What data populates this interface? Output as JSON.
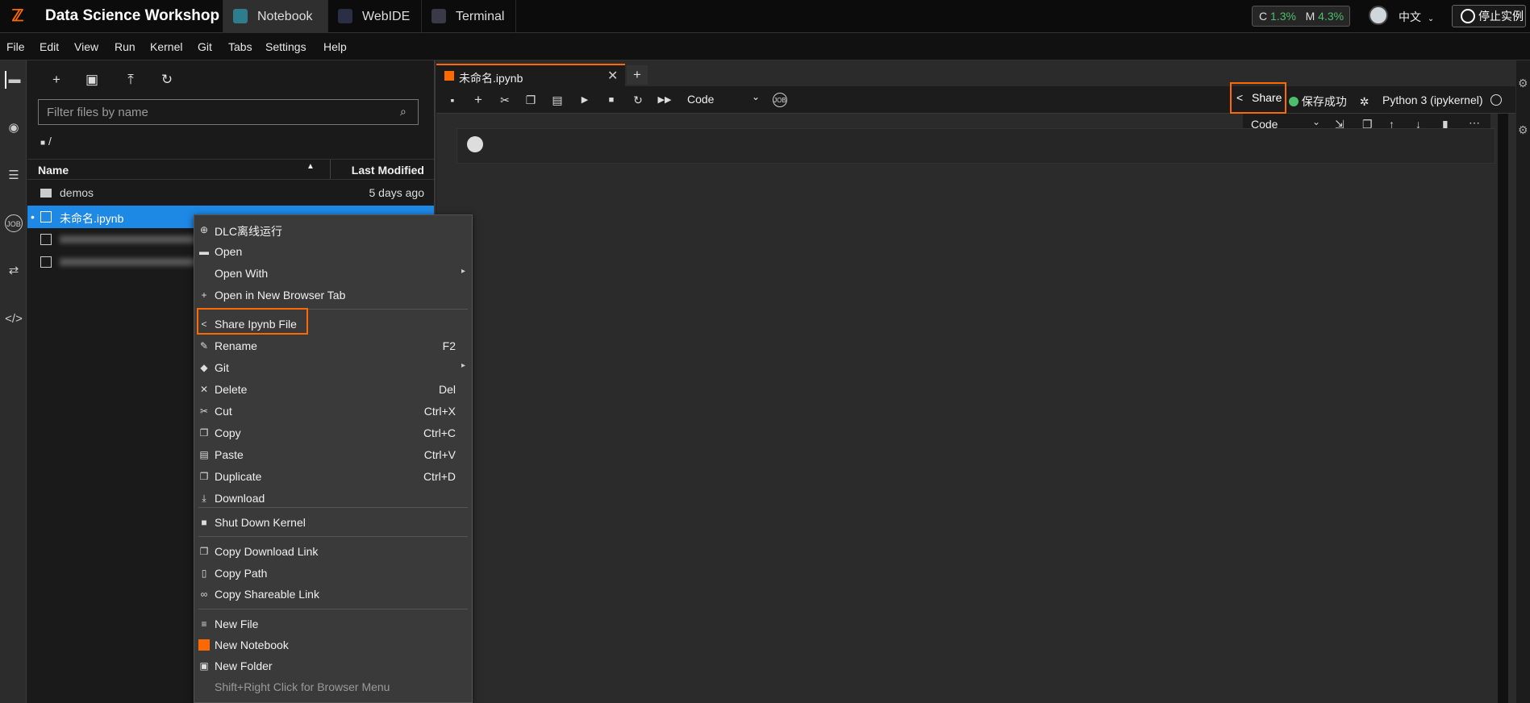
{
  "topbar": {
    "brand": "Data Science Workshop",
    "tabs": [
      {
        "label": "Notebook",
        "icon": "notebook-icon"
      },
      {
        "label": "WebIDE",
        "icon": "code-icon"
      },
      {
        "label": "Terminal",
        "icon": "terminal-icon"
      }
    ],
    "metrics_c_label": "C",
    "metrics_c_value": "1.3%",
    "metrics_m_label": "M",
    "metrics_m_value": "4.3%",
    "language": "中文",
    "stop_label": "停止实例"
  },
  "menubar": [
    "File",
    "Edit",
    "View",
    "Run",
    "Kernel",
    "Git",
    "Tabs",
    "Settings",
    "Help"
  ],
  "filebrowser": {
    "filter_placeholder": "Filter files by name",
    "breadcrumb": "/",
    "col_name": "Name",
    "col_modified": "Last Modified",
    "files": [
      {
        "name": "demos",
        "type": "folder",
        "modified": "5 days ago"
      },
      {
        "name": "未命名.ipynb",
        "type": "notebook",
        "modified": ""
      }
    ]
  },
  "notebook": {
    "tab_title": "未命名.ipynb",
    "cell_type": "Code",
    "share_label": "Share",
    "save_status": "保存成功",
    "kernel_name": "Python 3 (ipykernel)",
    "cell_toolbar_type": "Code"
  },
  "context_menu": {
    "items": [
      {
        "label": "DLC离线运行",
        "shortcut": "",
        "icon": "globe-icon"
      },
      {
        "label": "Open",
        "shortcut": "",
        "icon": "folder-icon"
      },
      {
        "label": "Open With",
        "shortcut": "",
        "icon": ""
      },
      {
        "label": "Open in New Browser Tab",
        "shortcut": "",
        "icon": "plus-icon"
      },
      {
        "label": "Share Ipynb File",
        "shortcut": "",
        "icon": "share-icon"
      },
      {
        "label": "Rename",
        "shortcut": "F2",
        "icon": "pencil-icon"
      },
      {
        "label": "Git",
        "shortcut": "",
        "icon": "git-icon"
      },
      {
        "label": "Delete",
        "shortcut": "Del",
        "icon": "close-icon"
      },
      {
        "label": "Cut",
        "shortcut": "Ctrl+X",
        "icon": "scissors-icon"
      },
      {
        "label": "Copy",
        "shortcut": "Ctrl+C",
        "icon": "copy-icon"
      },
      {
        "label": "Paste",
        "shortcut": "Ctrl+V",
        "icon": "paste-icon"
      },
      {
        "label": "Duplicate",
        "shortcut": "Ctrl+D",
        "icon": "duplicate-icon"
      },
      {
        "label": "Download",
        "shortcut": "",
        "icon": "download-icon"
      },
      {
        "label": "Shut Down Kernel",
        "shortcut": "",
        "icon": "stop-icon"
      },
      {
        "label": "Copy Download Link",
        "shortcut": "",
        "icon": "copy-icon"
      },
      {
        "label": "Copy Path",
        "shortcut": "",
        "icon": "file-icon"
      },
      {
        "label": "Copy Shareable Link",
        "shortcut": "",
        "icon": "link-icon"
      },
      {
        "label": "New File",
        "shortcut": "",
        "icon": "text-file-icon"
      },
      {
        "label": "New Notebook",
        "shortcut": "",
        "icon": "notebook-icon"
      },
      {
        "label": "New Folder",
        "shortcut": "",
        "icon": "new-folder-icon"
      }
    ],
    "hint": "Shift+Right Click for Browser Menu"
  }
}
